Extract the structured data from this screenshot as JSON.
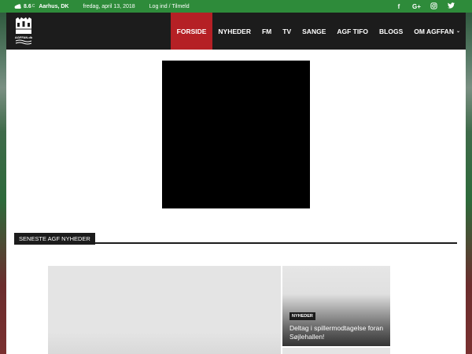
{
  "topbar": {
    "weather_icon": "cloud-sun-icon",
    "temperature": "8.6",
    "temperature_unit": "C",
    "location": "Aarhus, DK",
    "date": "fredag, april 13, 2018",
    "login": "Log ind / Tilmeld",
    "socials": [
      {
        "icon": "facebook-icon",
        "glyph": "f"
      },
      {
        "icon": "google-plus-icon",
        "glyph": "G+"
      },
      {
        "icon": "instagram-icon",
        "glyph": "◎"
      },
      {
        "icon": "twitter-icon",
        "glyph": "🐦"
      }
    ]
  },
  "header": {
    "logo_text": "AGFFAN.dk",
    "nav": [
      {
        "label": "FORSIDE",
        "active": true
      },
      {
        "label": "NYHEDER"
      },
      {
        "label": "FM"
      },
      {
        "label": "TV"
      },
      {
        "label": "SANGE"
      },
      {
        "label": "AGF TIFO"
      },
      {
        "label": "BLOGS"
      },
      {
        "label": "OM AGFFAN",
        "caret": "⌄"
      }
    ]
  },
  "main": {
    "section_title": "SENESTE AGF NYHEDER",
    "featured_small": {
      "tag": "NYHEDER",
      "title": "Deltag i spillermodtagelse foran Søjlehallen!"
    }
  },
  "colors": {
    "topbar": "#2e8b3a",
    "header": "#1c1c1c",
    "active_nav": "#b52025"
  }
}
